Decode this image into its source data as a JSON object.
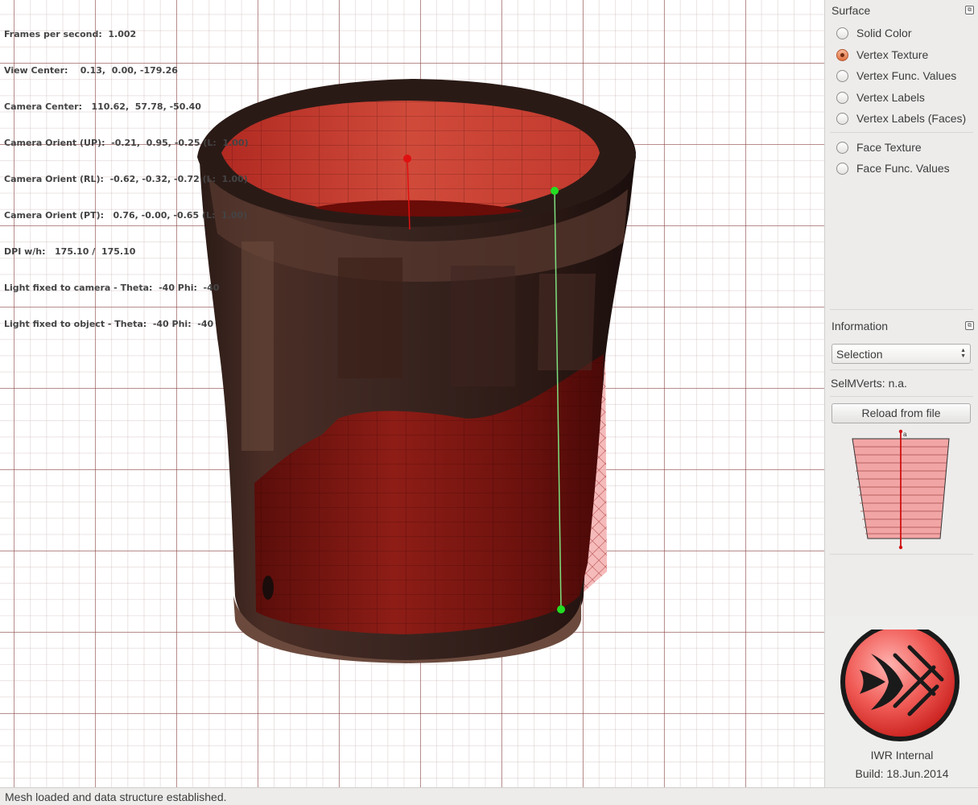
{
  "viewport": {
    "info_lines": [
      "Frames per second:  1.002",
      "View Center:    0.13,  0.00, -179.26",
      "Camera Center:   110.62,  57.78, -50.40",
      "Camera Orient (UP):  -0.21,  0.95, -0.25 (L:  1.00)",
      "Camera Orient (RL):  -0.62, -0.32, -0.72 (L:  1.00)",
      "Camera Orient (PT):   0.76, -0.00, -0.65 (L:  1.00)",
      "DPI w/h:   175.10 /  175.10",
      "Light fixed to camera - Theta:  -40 Phi:  -40",
      "Light fixed to object - Theta:  -40 Phi:  -40"
    ]
  },
  "surface_panel": {
    "title": "Surface",
    "options": [
      {
        "label": "Solid Color",
        "checked": false
      },
      {
        "label": "Vertex Texture",
        "checked": true
      },
      {
        "label": "Vertex Func. Values",
        "checked": false
      },
      {
        "label": "Vertex Labels",
        "checked": false
      },
      {
        "label": "Vertex Labels (Faces)",
        "checked": false
      },
      {
        "label": "Face Texture",
        "checked": false
      },
      {
        "label": "Face Func. Values",
        "checked": false
      }
    ]
  },
  "information_panel": {
    "title": "Information",
    "select_value": "Selection",
    "selmverts": "SelMVerts: n.a.",
    "reload_label": "Reload from file",
    "preview_label": "a"
  },
  "logo": {
    "line1": "IWR Internal",
    "line2": "Build: 18.Jun.2014"
  },
  "status_bar": {
    "message": "Mesh loaded and data structure established."
  },
  "colors": {
    "accent_radio": "#e0703e",
    "grid": "#8c4646",
    "mesh_red": "#c0302a",
    "marker_green": "#22dd22",
    "marker_red": "#e01010"
  }
}
